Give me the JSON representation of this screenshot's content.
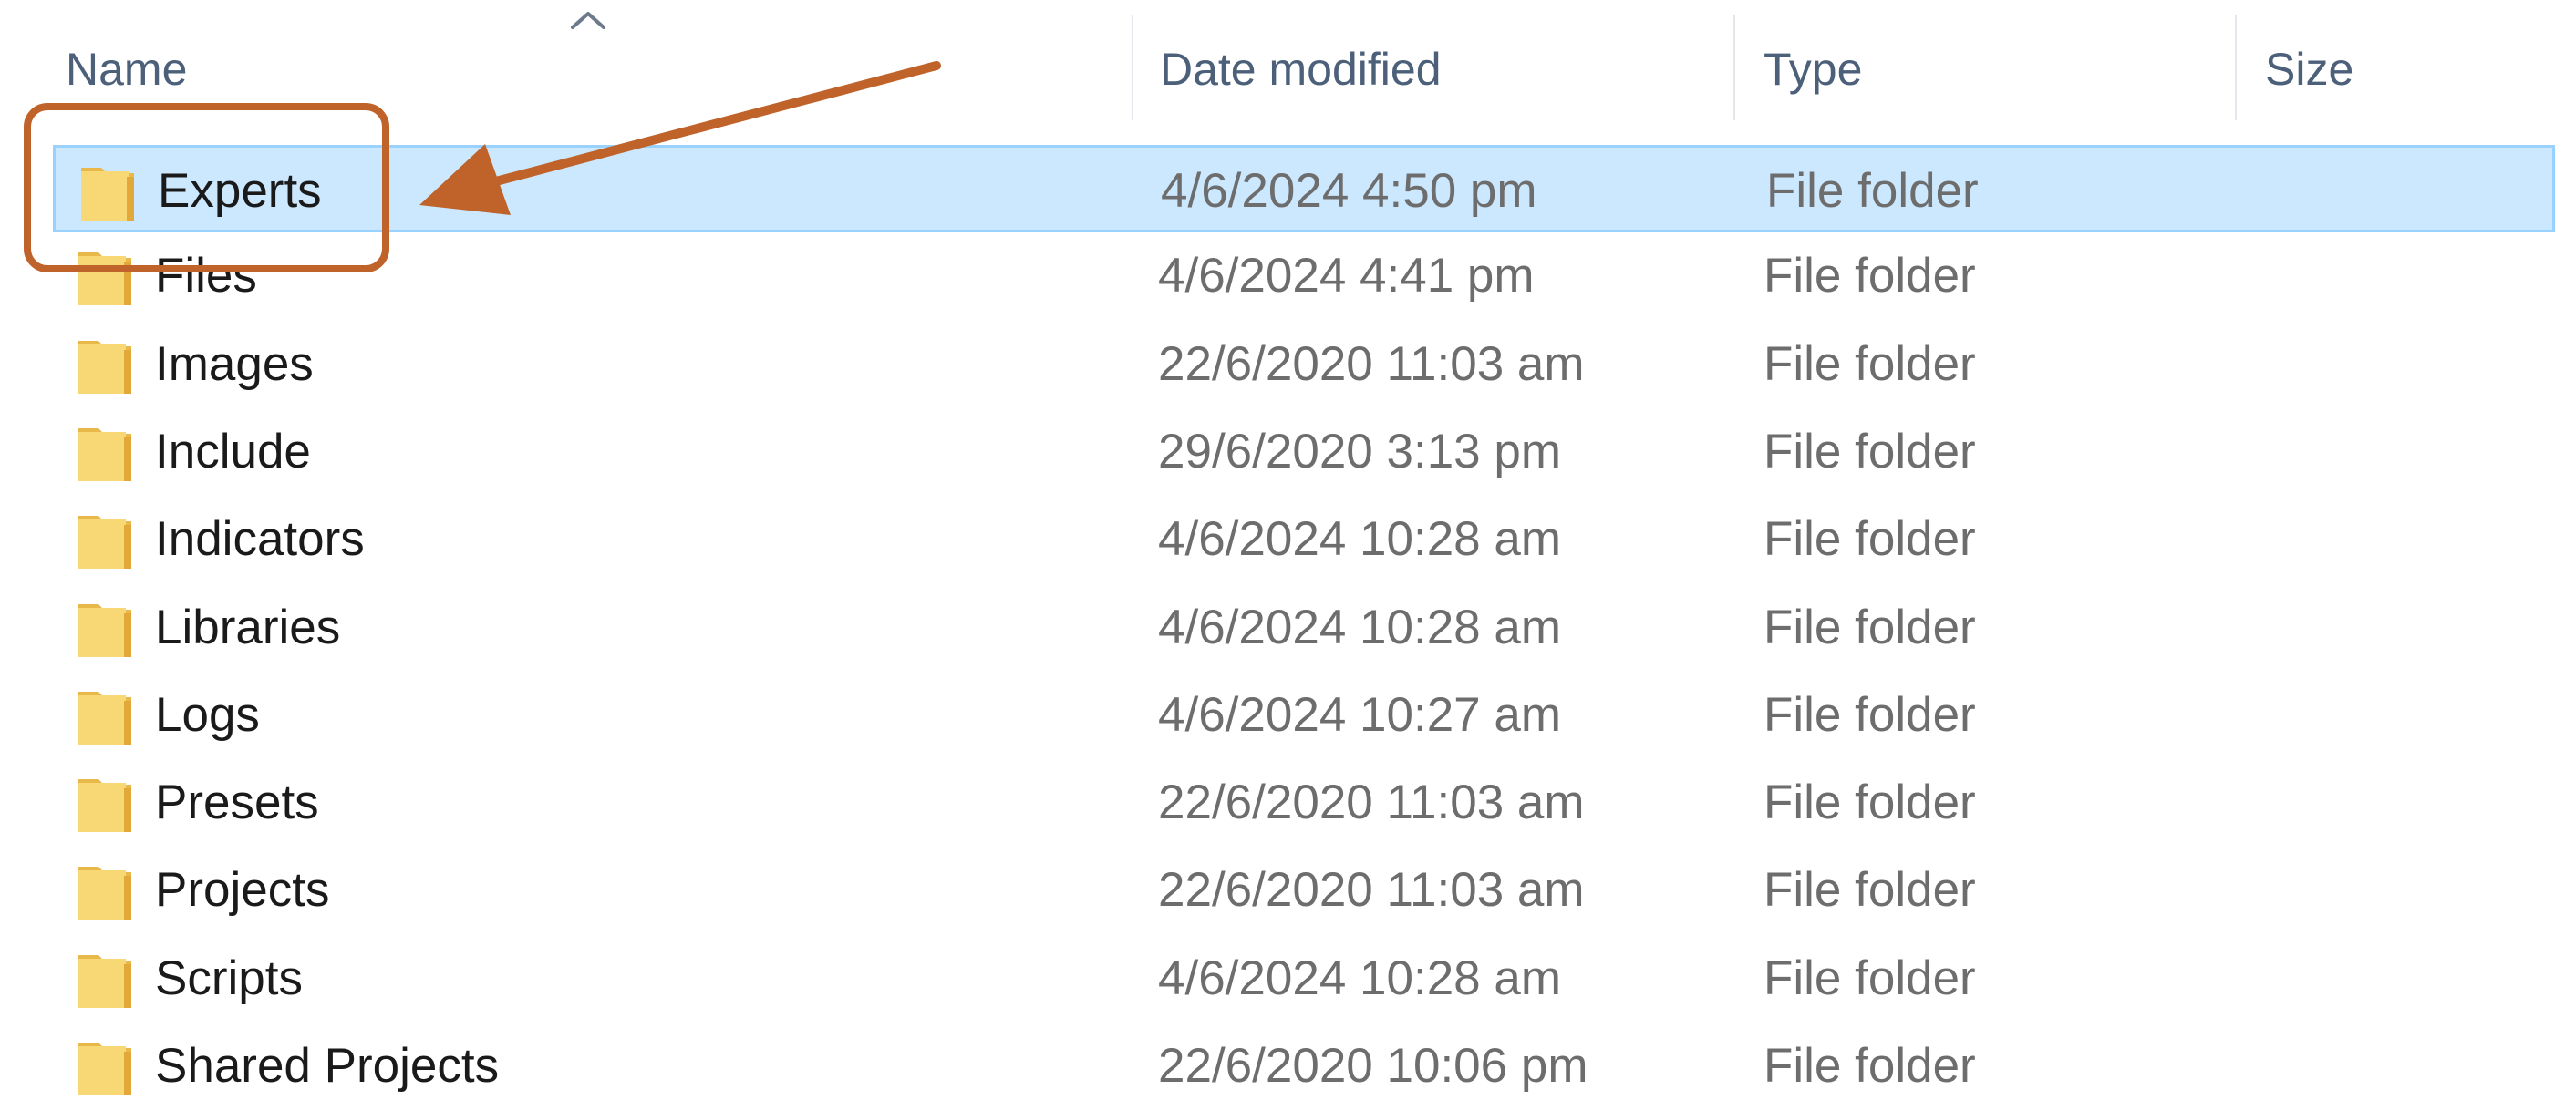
{
  "columns": {
    "name": "Name",
    "date_modified": "Date modified",
    "type": "Type",
    "size": "Size"
  },
  "sort": {
    "column": "Name",
    "direction": "ascending",
    "icon": "sort-up-icon"
  },
  "rows": [
    {
      "name": "Experts",
      "date": "4/6/2024 4:50 pm",
      "type": "File folder",
      "selected": true
    },
    {
      "name": "Files",
      "date": "4/6/2024 4:41 pm",
      "type": "File folder",
      "selected": false
    },
    {
      "name": "Images",
      "date": "22/6/2020 11:03 am",
      "type": "File folder",
      "selected": false
    },
    {
      "name": "Include",
      "date": "29/6/2020 3:13 pm",
      "type": "File folder",
      "selected": false
    },
    {
      "name": "Indicators",
      "date": "4/6/2024 10:28 am",
      "type": "File folder",
      "selected": false
    },
    {
      "name": "Libraries",
      "date": "4/6/2024 10:28 am",
      "type": "File folder",
      "selected": false
    },
    {
      "name": "Logs",
      "date": "4/6/2024 10:27 am",
      "type": "File folder",
      "selected": false
    },
    {
      "name": "Presets",
      "date": "22/6/2020 11:03 am",
      "type": "File folder",
      "selected": false
    },
    {
      "name": "Projects",
      "date": "22/6/2020 11:03 am",
      "type": "File folder",
      "selected": false
    },
    {
      "name": "Scripts",
      "date": "4/6/2024 10:28 am",
      "type": "File folder",
      "selected": false
    },
    {
      "name": "Shared Projects",
      "date": "22/6/2020 10:06 pm",
      "type": "File folder",
      "selected": false
    }
  ],
  "icons": {
    "folder": "folder-icon"
  },
  "colors": {
    "selection_fill": "#cce8ff",
    "selection_border": "#99d1ff",
    "folder_yellow": "#f8d775",
    "annotation": "#c0632a"
  }
}
